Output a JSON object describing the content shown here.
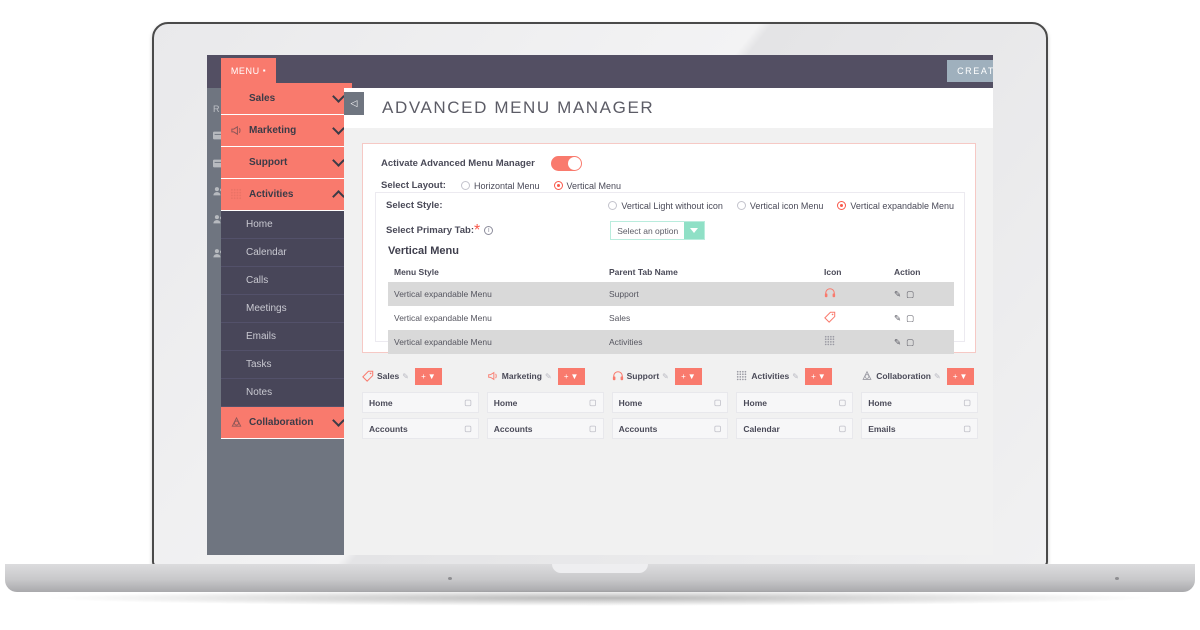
{
  "topbar": {
    "menu_button": "MENU",
    "menu_dot": "▪",
    "create_button": "CREAT"
  },
  "rail": {
    "items": [
      {
        "label": "R",
        "icon": "report-icon"
      },
      {
        "label": "",
        "icon": "document-icon"
      },
      {
        "label": "",
        "icon": "document-icon"
      },
      {
        "label": "",
        "icon": "user-icon"
      },
      {
        "label": "",
        "icon": "user-icon"
      },
      {
        "label": "",
        "icon": "user-icon"
      }
    ]
  },
  "dropdown": {
    "groups": [
      {
        "label": "Sales",
        "icon": "none",
        "state": "collapsed",
        "chevron": "down"
      },
      {
        "label": "Marketing",
        "icon": "megaphone-icon",
        "state": "collapsed",
        "chevron": "down"
      },
      {
        "label": "Support",
        "icon": "none",
        "state": "collapsed",
        "chevron": "down"
      },
      {
        "label": "Activities",
        "icon": "grid-icon",
        "state": "expanded",
        "chevron": "up"
      }
    ],
    "sub_items": [
      "Home",
      "Calendar",
      "Calls",
      "Meetings",
      "Emails",
      "Tasks",
      "Notes"
    ],
    "last_group": {
      "label": "Collaboration",
      "icon": "collab-icon",
      "chevron": "down"
    }
  },
  "page": {
    "title": "ADVANCED MENU MANAGER",
    "collapse_icon": "◁"
  },
  "form": {
    "activate_label": "Activate Advanced Menu Manager",
    "toggle_on": true,
    "layout_label": "Select Layout:",
    "layout_options": [
      {
        "label": "Horizontal Menu",
        "selected": false
      },
      {
        "label": "Vertical Menu",
        "selected": true
      }
    ],
    "style_label": "Select Style:",
    "style_options": [
      {
        "label": "Vertical Light without icon",
        "selected": false
      },
      {
        "label": "Vertical icon Menu",
        "selected": false
      },
      {
        "label": "Vertical expandable Menu",
        "selected": true
      }
    ],
    "primary_tab_label": "Select Primary Tab:",
    "primary_tab_required": "*",
    "primary_tab_info": "i",
    "select_value": "Select an option"
  },
  "vertical_menu_table": {
    "title": "Vertical Menu",
    "columns": [
      "Menu Style",
      "Parent Tab Name",
      "Icon",
      "Action"
    ],
    "rows": [
      {
        "style": "Vertical expandable Menu",
        "parent": "Support",
        "icon": "headset-icon"
      },
      {
        "style": "Vertical expandable Menu",
        "parent": "Sales",
        "icon": "tag-icon"
      },
      {
        "style": "Vertical expandable Menu",
        "parent": "Activities",
        "icon": "grid-icon"
      }
    ],
    "action_edit": "✎",
    "action_delete": "Ὕ1"
  },
  "tab_cards": [
    {
      "name": "Sales",
      "icon": "tag-icon",
      "add_label": "+",
      "items": [
        "Home",
        "Accounts"
      ]
    },
    {
      "name": "Marketing",
      "icon": "megaphone-icon",
      "add_label": "+",
      "items": [
        "Home",
        "Accounts"
      ]
    },
    {
      "name": "Support",
      "icon": "headset-icon",
      "add_label": "+",
      "items": [
        "Home",
        "Accounts"
      ]
    },
    {
      "name": "Activities",
      "icon": "grid-icon",
      "add_label": "+",
      "items": [
        "Home",
        "Calendar"
      ]
    },
    {
      "name": "Collaboration",
      "icon": "collab-icon",
      "add_label": "+",
      "items": [
        "Home",
        "Emails"
      ]
    }
  ],
  "colors": {
    "coral": "#f97a6d",
    "dark": "#534f63",
    "rail": "#6f7580",
    "submenu": "#484659",
    "mint": "#8fe0c6",
    "create": "#9fb0bd",
    "border_pink": "#f6c9c5"
  }
}
